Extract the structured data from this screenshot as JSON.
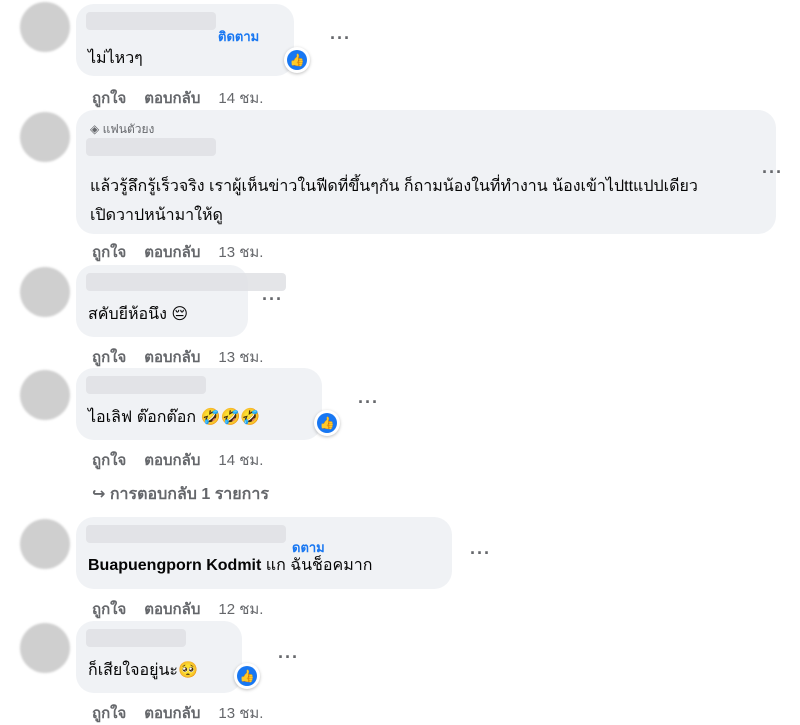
{
  "comments": [
    {
      "author_suffix": "ติดตาม",
      "text": "ไม่ไหวๆ",
      "like": "ถูกใจ",
      "reply": "ตอบกลับ",
      "time": "14 ชม."
    },
    {
      "badge": "แฟนตัวยง",
      "text": "แล้วรู้ลึกรู้เร็วจริง เราผู้เห็นข่าวในฟีดที่ขึ้นๆกัน ก็ถามน้องในที่ทำงาน น้องเข้าไปttแปปเดียว เปิดวาปหน้ามาให้ดู",
      "like": "ถูกใจ",
      "reply": "ตอบกลับ",
      "time": "13 ชม."
    },
    {
      "text": "สคับยีห้อนึง",
      "emoji": "😔",
      "like": "ถูกใจ",
      "reply": "ตอบกลับ",
      "time": "13 ชม."
    },
    {
      "text": "ไอเลิฟ ต๊อกต๊อก",
      "emoji": "🤣🤣🤣",
      "like": "ถูกใจ",
      "reply": "ตอบกลับ",
      "time": "14 ชม.",
      "replies_link": "↪ การตอบกลับ 1 รายการ"
    },
    {
      "author_suffix": "ดตาม",
      "mention": "Buapuengporn Kodmit",
      "text": "แก ฉันช็อคมาก",
      "like": "ถูกใจ",
      "reply": "ตอบกลับ",
      "time": "12 ชม."
    },
    {
      "text": "ก็เสียใจอยู่นะ",
      "emoji": "🥺",
      "like": "ถูกใจ",
      "reply": "ตอบกลับ",
      "time": "13 ชม."
    }
  ],
  "icons": {
    "more": "more-dots-icon",
    "like_reaction": "like-thumb-icon",
    "fan": "diamond-icon",
    "reply_arrow": "reply-arrow-icon"
  },
  "colors": {
    "bubble": "#f0f2f5",
    "meta": "#65676b",
    "like_blue": "#1877f2"
  }
}
